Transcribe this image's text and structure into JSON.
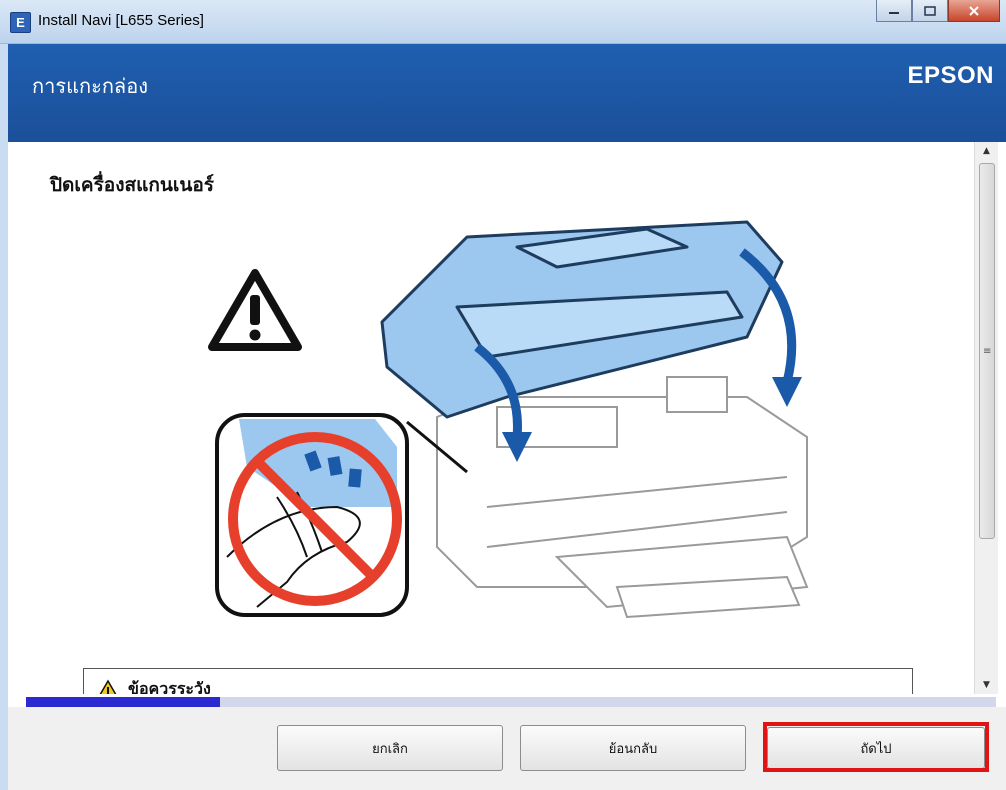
{
  "window": {
    "title": "Install Navi [L655 Series]",
    "icon": "E",
    "buttons": [
      "minimize-icon",
      "maximize-icon",
      "close-icon"
    ]
  },
  "header": {
    "title": "การแกะกล่อง",
    "brand": "EPSON"
  },
  "content": {
    "heading": "ปิดเครื่องสแกนเนอร์",
    "caution_text": "ข้อควรระวัง"
  },
  "progress": {
    "value": 0.2
  },
  "footer": {
    "cancel_label": "ยกเลิก",
    "back_label": "ย้อนกลับ",
    "next_label": "ถัดไป"
  },
  "colors": {
    "header_blue": "#1f5fb1",
    "highlight_red": "#e01414",
    "progress_blue": "#2a2ad0",
    "printer_blue": "#9cc7ee"
  }
}
